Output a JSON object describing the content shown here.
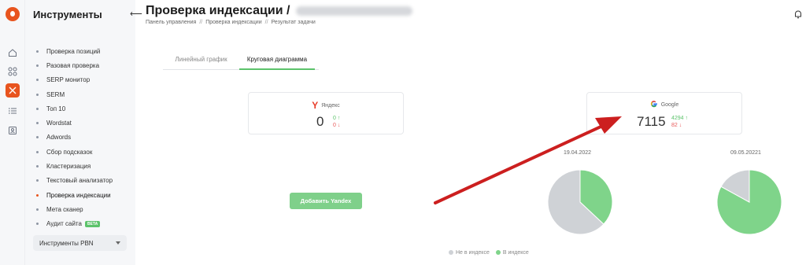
{
  "sidebar": {
    "title": "Инструменты",
    "items": [
      {
        "label": "Проверка позиций",
        "active": false
      },
      {
        "label": "Разовая проверка",
        "active": false
      },
      {
        "label": "SERP монитор",
        "active": false
      },
      {
        "label": "SERM",
        "active": false
      },
      {
        "label": "Топ 10",
        "active": false
      },
      {
        "label": "Wordstat",
        "active": false
      },
      {
        "label": "Adwords",
        "active": false
      },
      {
        "label": "Сбор подсказок",
        "active": false
      },
      {
        "label": "Кластеризация",
        "active": false
      },
      {
        "label": "Текстовый анализатор",
        "active": false
      },
      {
        "label": "Проверка индексации",
        "active": true
      },
      {
        "label": "Мета сканер",
        "active": false
      },
      {
        "label": "Аудит сайта",
        "active": false,
        "badge": "BETA"
      }
    ],
    "pbn_label": "Инструменты PBN"
  },
  "header": {
    "title": "Проверка индексации /",
    "breadcrumbs": [
      "Панель управления",
      "Проверка индексации",
      "Результат задачи"
    ],
    "separator": "//"
  },
  "tabs": [
    {
      "label": "Линейный график",
      "active": false
    },
    {
      "label": "Круговая диаграмма",
      "active": true
    }
  ],
  "yandex": {
    "name": "Яндекс",
    "count": "0",
    "up": "0",
    "down": "0"
  },
  "google": {
    "name": "Google",
    "count": "7115",
    "up": "4294",
    "down": "82"
  },
  "add_yandex_label": "Добавить Yandex",
  "colors": {
    "accent": "#e8541e",
    "green": "#7fd48a",
    "grey": "#cfd2d6",
    "red_arrow": "#cc1f1f"
  },
  "chart_data": [
    {
      "type": "pie",
      "title": "19.04.2022",
      "categories": [
        "Не в индексе",
        "В индексе"
      ],
      "values": [
        0.63,
        0.37
      ]
    },
    {
      "type": "pie",
      "title": "09.05.20221",
      "categories": [
        "Не в индексе",
        "В индексе"
      ],
      "values": [
        0.17,
        0.83
      ]
    }
  ],
  "legend": [
    {
      "label": "Не в индексе",
      "color": "#cfd2d6"
    },
    {
      "label": "В индексе",
      "color": "#7fd48a"
    }
  ]
}
